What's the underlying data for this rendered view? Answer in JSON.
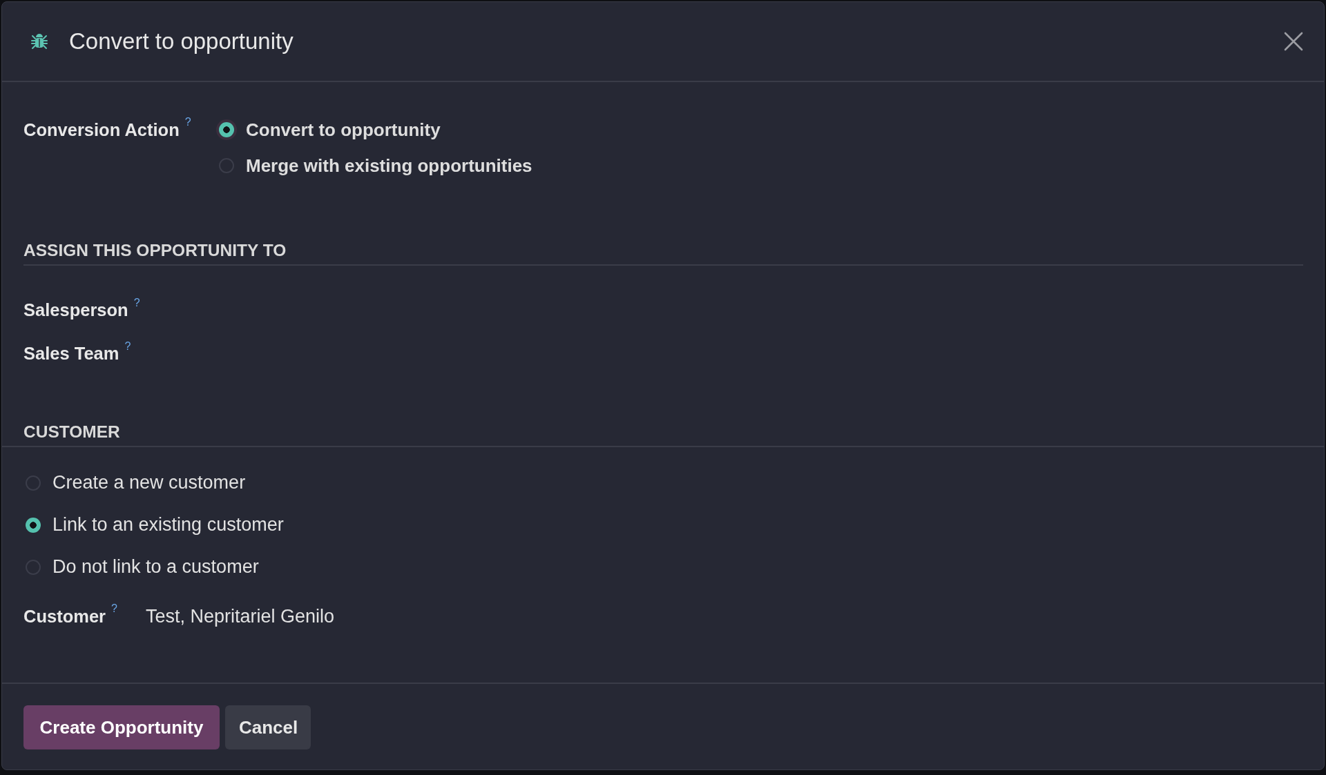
{
  "dialog": {
    "title": "Convert to opportunity"
  },
  "conversion_action": {
    "label": "Conversion Action",
    "help": "?",
    "options": [
      {
        "label": "Convert to opportunity",
        "selected": true,
        "focused": true
      },
      {
        "label": "Merge with existing opportunities",
        "selected": false,
        "focused": false
      }
    ]
  },
  "assign_section": {
    "title": "ASSIGN THIS OPPORTUNITY TO",
    "fields": [
      {
        "label": "Salesperson",
        "help": "?"
      },
      {
        "label": "Sales Team",
        "help": "?"
      }
    ]
  },
  "customer_section": {
    "title": "CUSTOMER",
    "options": [
      {
        "label": "Create a new customer",
        "selected": false
      },
      {
        "label": "Link to an existing customer",
        "selected": true
      },
      {
        "label": "Do not link to a customer",
        "selected": false
      }
    ],
    "customer_field": {
      "label": "Customer",
      "help": "?",
      "value": "Test, Nepritariel Genilo"
    }
  },
  "buttons": [
    {
      "label": "Create Opportunity",
      "kind": "primary"
    },
    {
      "label": "Cancel",
      "kind": "secondary"
    }
  ]
}
